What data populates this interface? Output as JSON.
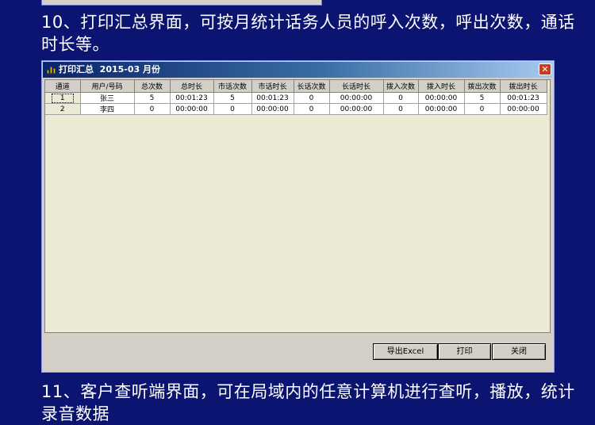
{
  "heading_10": "10、打印汇总界面，可按月统计话务人员的呼入次数，呼出次数，通话时长等。",
  "heading_11": "11、客户查听端界面，可在局域内的任意计算机进行查听，播放，统计录音数据",
  "window": {
    "title": "打印汇总  2015-03 月份",
    "close_glyph": "✕",
    "app_icon": "bar-chart-icon"
  },
  "table": {
    "columns": [
      "通道",
      "用户/号码",
      "总次数",
      "总时长",
      "市话次数",
      "市话时长",
      "长话次数",
      "长话时长",
      "拨入次数",
      "拨入时长",
      "拨出次数",
      "拨出时长"
    ],
    "rows": [
      [
        "1",
        "张三",
        "5",
        "00:01:23",
        "5",
        "00:01:23",
        "0",
        "00:00:00",
        "0",
        "00:00:00",
        "5",
        "00:01:23"
      ],
      [
        "2",
        "李四",
        "0",
        "00:00:00",
        "0",
        "00:00:00",
        "0",
        "00:00:00",
        "0",
        "00:00:00",
        "0",
        "00:00:00"
      ]
    ]
  },
  "buttons": {
    "export": "导出Excel",
    "print": "打印",
    "close": "关闭"
  },
  "colors": {
    "page_background": "#0b1470",
    "titlebar_start": "#0a246a",
    "titlebar_end": "#a6caf0",
    "window_face": "#d4d0c8",
    "grid_background": "#ecead4"
  }
}
